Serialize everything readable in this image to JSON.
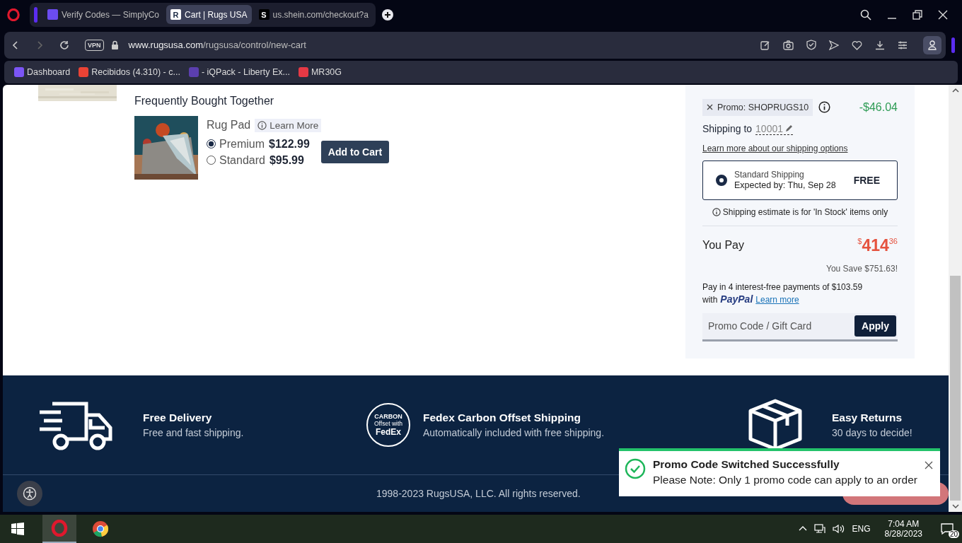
{
  "browser": {
    "tabs": [
      {
        "title": "Verify Codes — SimplyCo",
        "favicon": {
          "kind": "mark"
        },
        "selected": false
      },
      {
        "title": "Cart | Rugs USA",
        "favicon": {
          "kind": "light",
          "letter": "R"
        },
        "selected": true
      },
      {
        "title": "us.shein.com/checkout?a",
        "favicon": {
          "kind": "dark",
          "letter": "S"
        },
        "selected": false
      }
    ],
    "vpn": "VPN",
    "url_host": "www.rugsusa.com",
    "url_path": "/rugsusa/control/new-cart",
    "bookmarks": [
      {
        "label": "Dashboard",
        "kind": "purple"
      },
      {
        "label": "Recibidos (4.310) - c...",
        "kind": "gmail"
      },
      {
        "label": "- iQPack - Liberty Ex...",
        "kind": "swoosh"
      },
      {
        "label": "MR30G",
        "kind": "red"
      }
    ]
  },
  "frequently_bought": {
    "heading": "Frequently Bought Together",
    "product": "Rug Pad",
    "learn_more": "Learn More",
    "options": [
      {
        "name": "Premium",
        "price": "$122.99",
        "selected": true
      },
      {
        "name": "Standard",
        "price": "$95.99",
        "selected": false
      }
    ],
    "add_button": "Add to Cart"
  },
  "summary": {
    "promo_label": "Promo: SHOPRUGS10",
    "promo_amount": "-$46.04",
    "shipping_to": "Shipping to",
    "zip": "10001",
    "shipping_link": "Learn more about our shipping options",
    "shipping_option": {
      "name": "Standard Shipping",
      "expected": "Expected by: Thu, Sep 28",
      "price": "FREE",
      "selected": true
    },
    "estimate_note": "Shipping estimate is for 'In Stock' items only",
    "you_pay": "You Pay",
    "currency": "$",
    "total_whole": "414",
    "total_cents": "36",
    "you_save": "You Save $751.63!",
    "installments": "Pay in 4 interest-free payments of $103.59",
    "with": "with",
    "paypal": "PayPal",
    "paypal_link": "Learn more",
    "promo_placeholder": "Promo Code / Gift Card",
    "apply": "Apply"
  },
  "footer": {
    "features": [
      {
        "kind": "truck",
        "title": "Free Delivery",
        "subtitle": "Free and fast shipping."
      },
      {
        "kind": "fedex",
        "title": "Fedex Carbon Offset Shipping",
        "subtitle": "Automatically included with free shipping."
      },
      {
        "kind": "box",
        "title": "Easy Returns",
        "subtitle": "30 days to decide!"
      }
    ],
    "fedex_logo": [
      "CARBON",
      "Offset with",
      "FedEx"
    ],
    "copyright": "1998-2023 RugsUSA, LLC. All rights reserved."
  },
  "toast": {
    "title": "Promo Code Switched Successfully",
    "message": "Please Note: Only 1 promo code can apply to an order"
  },
  "taskbar": {
    "language": "ENG",
    "time": "7:04 AM",
    "date": "8/28/2023",
    "notifications": "20"
  }
}
